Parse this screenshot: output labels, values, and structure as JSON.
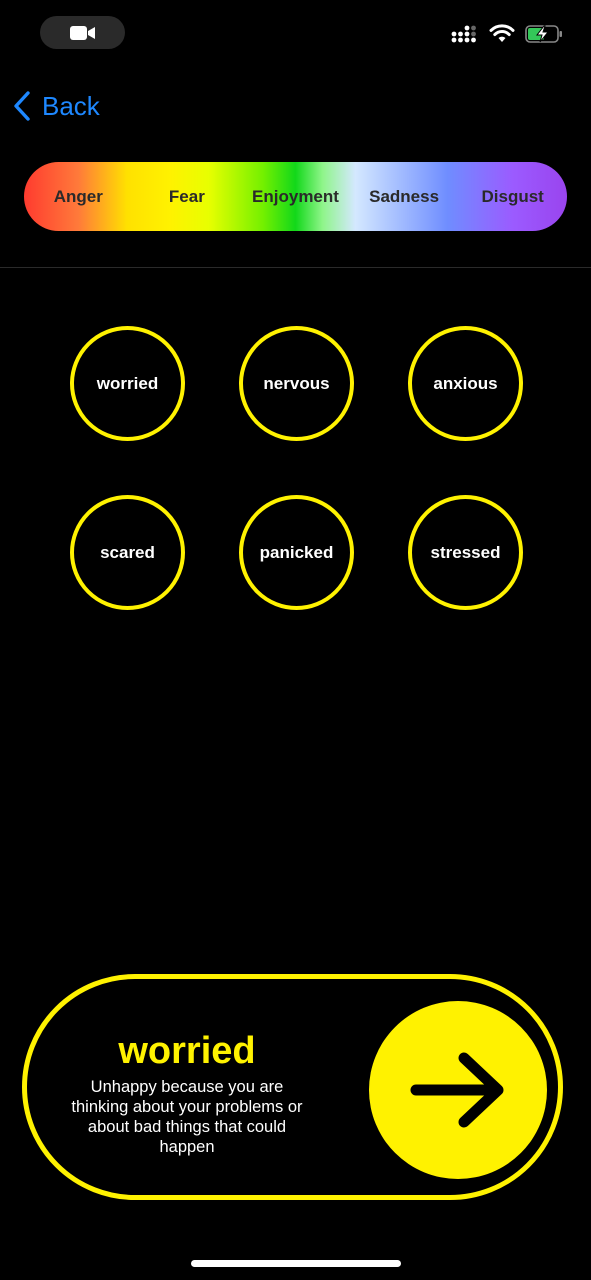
{
  "status_bar": {
    "icons": [
      "video-camera-icon",
      "cellular-signal-icon",
      "wifi-icon",
      "battery-charging-icon"
    ]
  },
  "nav": {
    "back_label": "Back"
  },
  "spectrum": {
    "items": [
      "Anger",
      "Fear",
      "Enjoyment",
      "Sadness",
      "Disgust"
    ]
  },
  "emotions": [
    "worried",
    "nervous",
    "anxious",
    "scared",
    "panicked",
    "stressed"
  ],
  "selected": {
    "title": "worried",
    "description": "Unhappy because you are thinking about your problems or about bad things that could happen"
  },
  "colors": {
    "background": "#000000",
    "accent": "#fff200",
    "link": "#1e88ff"
  }
}
